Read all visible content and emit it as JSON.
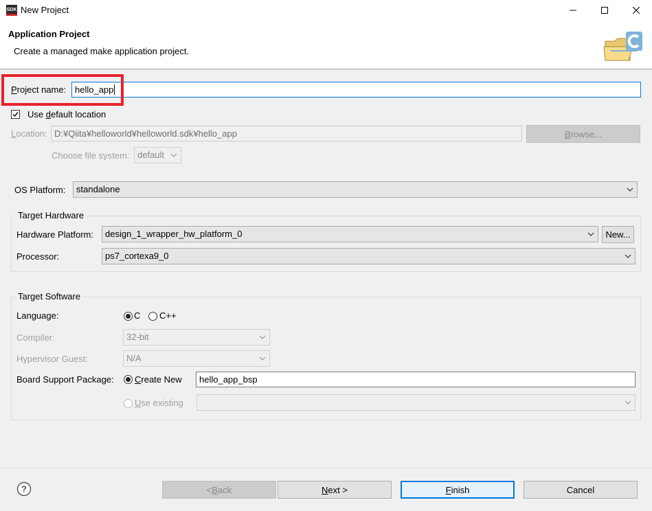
{
  "window": {
    "title": "New Project",
    "app_icon_text": "SDK"
  },
  "banner": {
    "title": "Application Project",
    "description": "Create a managed make application project."
  },
  "project": {
    "name_label_prefix": "P",
    "name_label_rest": "roject name:",
    "name_value": "hello_app"
  },
  "location": {
    "use_default_label_prefix": "Use ",
    "use_default_label_key": "d",
    "use_default_label_rest": "efault location",
    "use_default_checked": true,
    "label_key": "L",
    "label_rest": "ocation:",
    "value": "D:¥Qiita¥helloworld¥helloworld.sdk¥hello_app",
    "browse_label_key": "B",
    "browse_label_rest": "rowse...",
    "fs_label": "Choose file system:",
    "fs_value": "default"
  },
  "os": {
    "label": "OS Platform:",
    "value": "standalone"
  },
  "target_hardware": {
    "title": "Target Hardware",
    "platform_label": "Hardware Platform:",
    "platform_value": "design_1_wrapper_hw_platform_0",
    "new_label": "New...",
    "processor_label": "Processor:",
    "processor_value": "ps7_cortexa9_0"
  },
  "target_software": {
    "title": "Target Software",
    "language_label": "Language:",
    "language_options": [
      "C",
      "C++"
    ],
    "language_selected": "C",
    "compiler_label": "Compiler:",
    "compiler_value": "32-bit",
    "hypervisor_label": "Hypervisor Guest:",
    "hypervisor_value": "N/A",
    "bsp_label": "Board Support Package:",
    "bsp_create_key": "C",
    "bsp_create_rest": "reate New",
    "bsp_name": "hello_app_bsp",
    "bsp_existing_key": "U",
    "bsp_existing_rest": "se existing"
  },
  "footer": {
    "back_prefix": "< ",
    "back_key": "B",
    "back_rest": "ack",
    "next_key": "N",
    "next_rest": "ext >",
    "finish_key": "F",
    "finish_rest": "inish",
    "cancel": "Cancel"
  },
  "colors": {
    "highlight": "#e8222e",
    "default_button_border": "#0078d7"
  }
}
